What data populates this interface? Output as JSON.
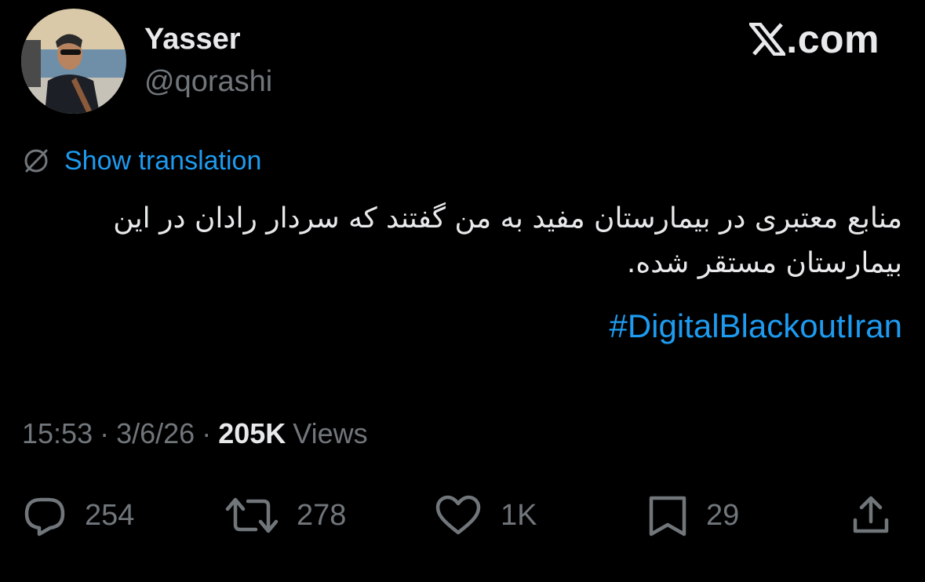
{
  "author": {
    "display_name": "Yasser",
    "handle": "@qorashi"
  },
  "brand": {
    "label": ".com",
    "icon": "x-logo-icon"
  },
  "translation": {
    "label": "Show translation",
    "icon": "globe-icon"
  },
  "tweet": {
    "text": "منابع معتبری در بیمارستان مفید به من گفتند که سردار رادان در این بیمارستان مستقر شده.",
    "hashtag": "#DigitalBlackoutIran"
  },
  "meta": {
    "time": "15:53",
    "separator": "·",
    "date": "3/6/26",
    "views_count": "205K",
    "views_label": "Views"
  },
  "actions": {
    "replies": {
      "icon": "reply-icon",
      "count": "254"
    },
    "reposts": {
      "icon": "repost-icon",
      "count": "278"
    },
    "likes": {
      "icon": "heart-icon",
      "count": "1K"
    },
    "bookmarks": {
      "icon": "bookmark-icon",
      "count": "29"
    },
    "share": {
      "icon": "share-icon"
    }
  },
  "colors": {
    "background": "#000000",
    "text_primary": "#e7e9ea",
    "text_secondary": "#71767b",
    "link": "#1d9bf0"
  }
}
